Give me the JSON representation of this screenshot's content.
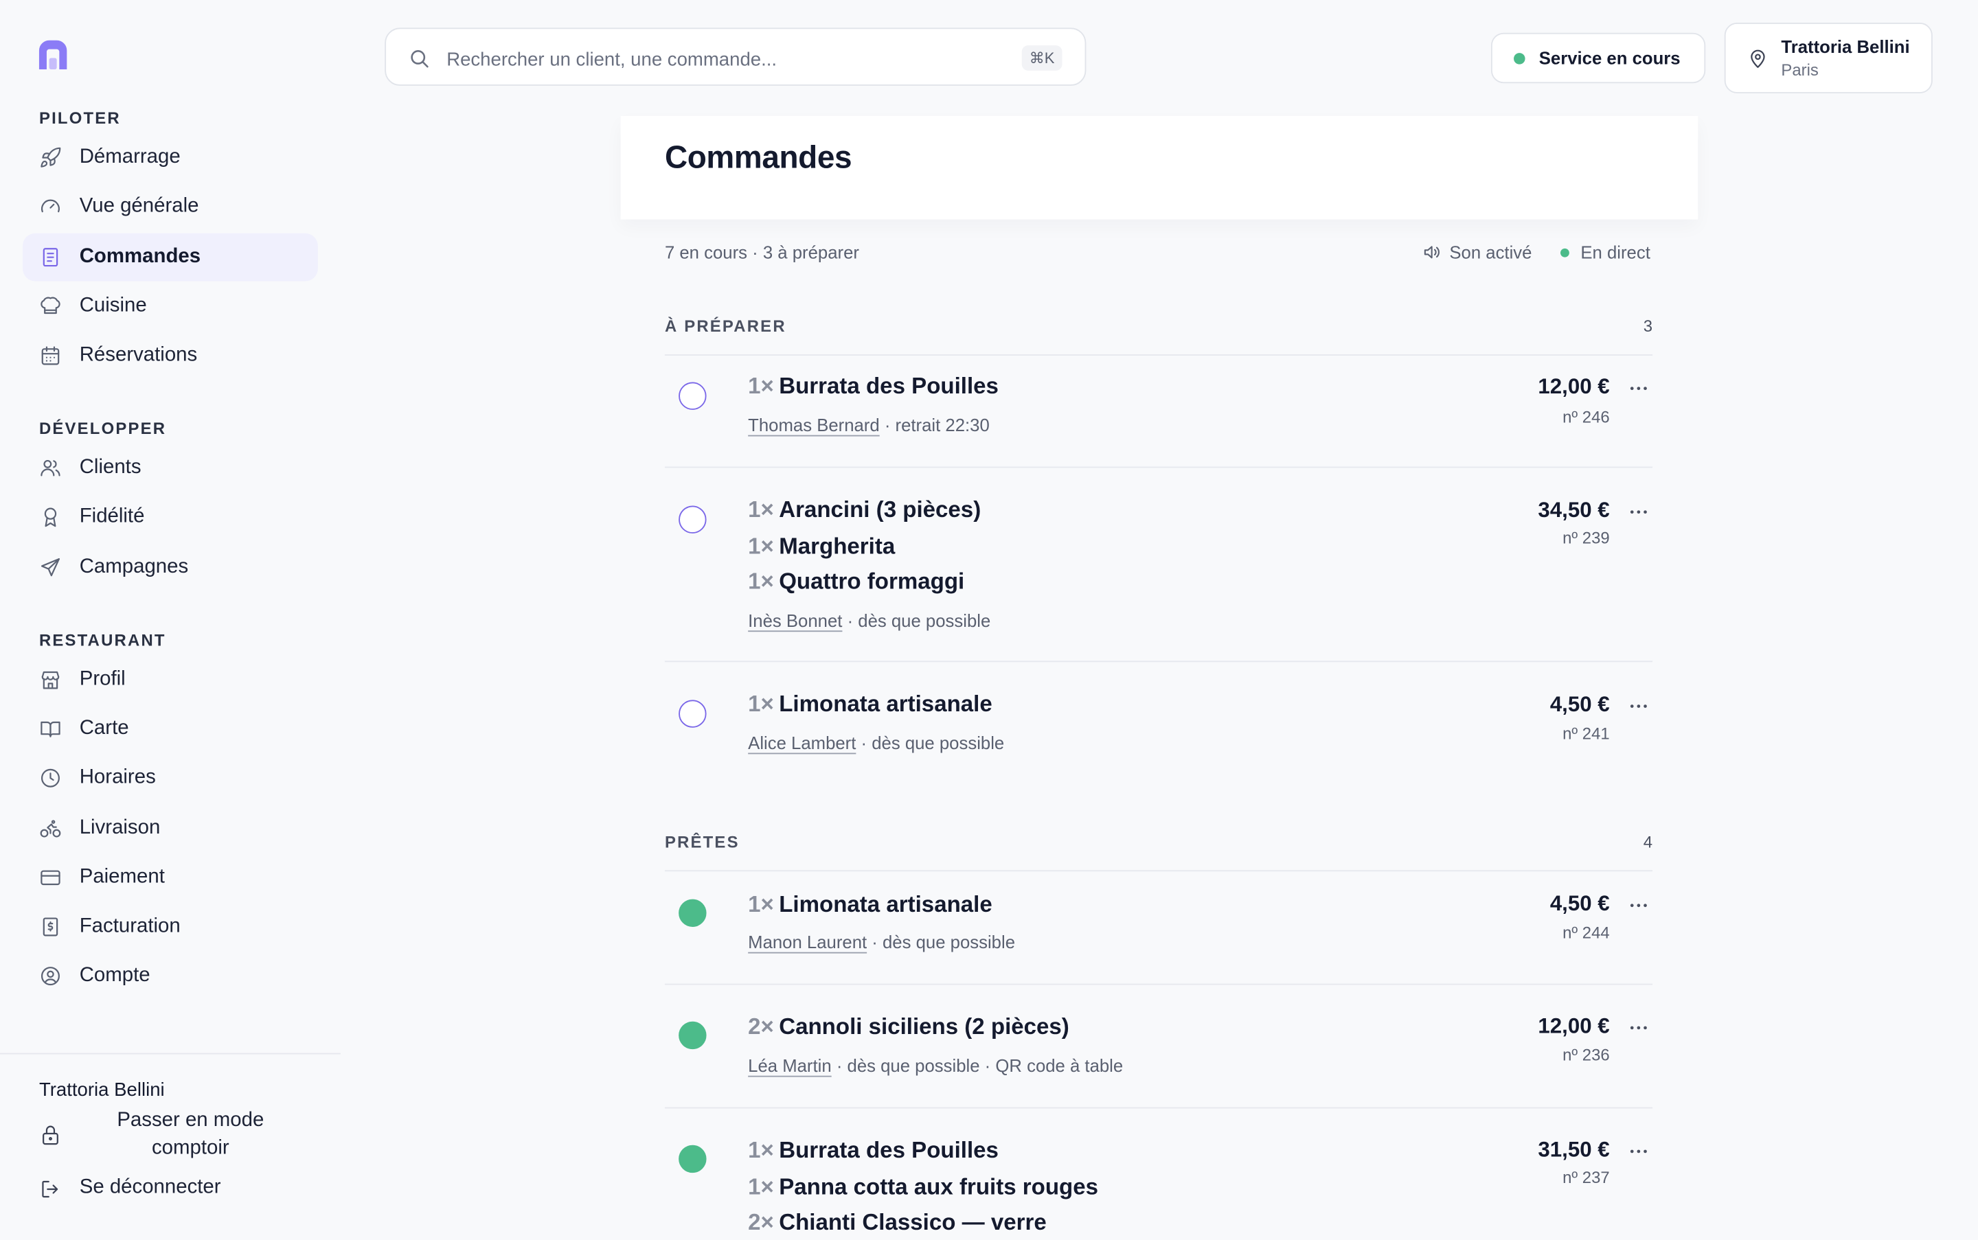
{
  "sidebar": {
    "sections": [
      {
        "title": "PILOTER",
        "items": [
          {
            "label": "Démarrage",
            "icon": "rocket-icon"
          },
          {
            "label": "Vue générale",
            "icon": "gauge-icon"
          },
          {
            "label": "Commandes",
            "icon": "receipt-icon",
            "active": true
          },
          {
            "label": "Cuisine",
            "icon": "chef-hat-icon"
          },
          {
            "label": "Réservations",
            "icon": "calendar-icon"
          }
        ]
      },
      {
        "title": "DÉVELOPPER",
        "items": [
          {
            "label": "Clients",
            "icon": "users-icon"
          },
          {
            "label": "Fidélité",
            "icon": "award-icon"
          },
          {
            "label": "Campagnes",
            "icon": "send-icon"
          }
        ]
      },
      {
        "title": "RESTAURANT",
        "items": [
          {
            "label": "Profil",
            "icon": "store-icon"
          },
          {
            "label": "Carte",
            "icon": "book-icon"
          },
          {
            "label": "Horaires",
            "icon": "clock-icon"
          },
          {
            "label": "Livraison",
            "icon": "bike-icon"
          },
          {
            "label": "Paiement",
            "icon": "credit-card-icon"
          },
          {
            "label": "Facturation",
            "icon": "invoice-icon"
          },
          {
            "label": "Compte",
            "icon": "user-circle-icon"
          }
        ]
      }
    ],
    "footer": {
      "restaurant_name": "Trattoria Bellini",
      "counter_mode_label": "Passer en mode comptoir",
      "logout_label": "Se déconnecter"
    }
  },
  "topbar": {
    "search": {
      "placeholder": "Rechercher un client, une commande...",
      "shortcut": "⌘K"
    },
    "service_status": "Service en cours",
    "restaurant": {
      "name": "Trattoria Bellini",
      "city": "Paris"
    }
  },
  "main": {
    "title": "Commandes",
    "summary": "7 en cours · 3 à préparer",
    "sound_label": "Son activé",
    "live_label": "En direct",
    "groups": [
      {
        "title": "À PRÉPARER",
        "count": "3",
        "orders": [
          {
            "items": [
              {
                "qty": "1×",
                "name": "Burrata des Pouilles"
              }
            ],
            "client": "Thomas Bernard",
            "details": " · retrait 22:30",
            "price": "12,00 €",
            "number": "nº 246"
          },
          {
            "items": [
              {
                "qty": "1×",
                "name": "Arancini (3 pièces)"
              },
              {
                "qty": "1×",
                "name": "Margherita"
              },
              {
                "qty": "1×",
                "name": "Quattro formaggi"
              }
            ],
            "client": "Inès Bonnet",
            "details": " · dès que possible",
            "price": "34,50 €",
            "number": "nº 239"
          },
          {
            "items": [
              {
                "qty": "1×",
                "name": "Limonata artisanale"
              }
            ],
            "client": "Alice Lambert",
            "details": " · dès que possible",
            "price": "4,50 €",
            "number": "nº 241"
          }
        ]
      },
      {
        "title": "PRÊTES",
        "count": "4",
        "orders": [
          {
            "items": [
              {
                "qty": "1×",
                "name": "Limonata artisanale"
              }
            ],
            "client": "Manon Laurent",
            "details": " · dès que possible",
            "price": "4,50 €",
            "number": "nº 244"
          },
          {
            "items": [
              {
                "qty": "2×",
                "name": "Cannoli siciliens (2 pièces)"
              }
            ],
            "client": "Léa Martin",
            "details": " · dès que possible · QR code à table",
            "price": "12,00 €",
            "number": "nº 236"
          },
          {
            "items": [
              {
                "qty": "1×",
                "name": "Burrata des Pouilles"
              },
              {
                "qty": "1×",
                "name": "Panna cotta aux fruits rouges"
              },
              {
                "qty": "2×",
                "name": "Chianti Classico — verre"
              }
            ],
            "client": "",
            "details": "",
            "price": "31,50 €",
            "number": "nº 237"
          }
        ]
      }
    ]
  },
  "colors": {
    "accent": "#7a67e8",
    "success": "#4cbb8a",
    "active_bg": "#f0f0fd"
  }
}
